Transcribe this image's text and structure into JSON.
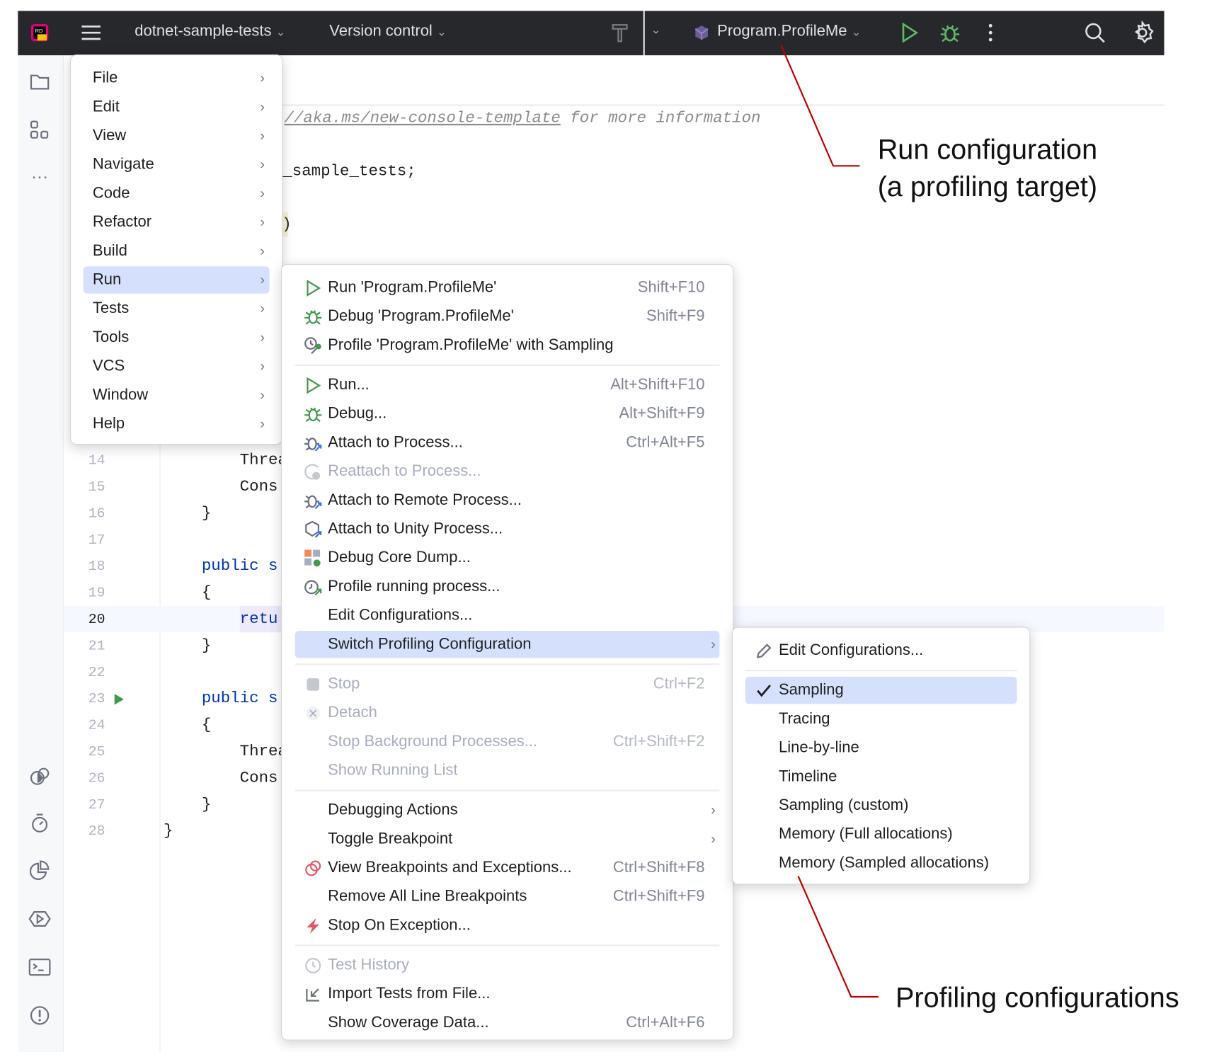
{
  "colors": {
    "accent": "#d5e1fc",
    "run_green": "#3f9a4a",
    "annotation_red": "#c00000",
    "topbar": "#27282c"
  },
  "topbar": {
    "project": "dotnet-sample-tests",
    "vcs": "Version control",
    "run_config": "Program.ProfileMe",
    "icons": [
      "ide-logo-icon",
      "hamburger-menu-icon",
      "hammer-icon",
      "config-icon",
      "run-icon",
      "debug-icon",
      "more-icon",
      "search-icon",
      "settings-icon"
    ]
  },
  "editor": {
    "top_lines": [
      {
        "text": "//aka.ms/new-console-template",
        "rest": " for more information"
      },
      {
        "text": "_sample_tests;"
      },
      {
        "text": ")"
      }
    ],
    "lines": [
      {
        "num": "14",
        "text": "        Threa"
      },
      {
        "num": "15",
        "text": "        Cons"
      },
      {
        "num": "16",
        "text": "    }"
      },
      {
        "num": "17",
        "text": ""
      },
      {
        "num": "18",
        "text": "    public s",
        "kw": true
      },
      {
        "num": "19",
        "text": "    {"
      },
      {
        "num": "20",
        "text": "        retu",
        "kw": true,
        "current": true
      },
      {
        "num": "21",
        "text": "    }"
      },
      {
        "num": "22",
        "text": ""
      },
      {
        "num": "23",
        "text": "    public s",
        "kw": true,
        "run": true
      },
      {
        "num": "24",
        "text": "    {"
      },
      {
        "num": "25",
        "text": "        Threa"
      },
      {
        "num": "26",
        "text": "        Cons"
      },
      {
        "num": "27",
        "text": "    }"
      },
      {
        "num": "28",
        "text": "}"
      }
    ]
  },
  "main_menu": [
    {
      "label": "File",
      "submenu": true
    },
    {
      "label": "Edit",
      "submenu": true
    },
    {
      "label": "View",
      "submenu": true
    },
    {
      "label": "Navigate",
      "submenu": true
    },
    {
      "label": "Code",
      "submenu": true
    },
    {
      "label": "Refactor",
      "submenu": true
    },
    {
      "label": "Build",
      "submenu": true
    },
    {
      "label": "Run",
      "submenu": true,
      "highlight": true
    },
    {
      "label": "Tests",
      "submenu": true
    },
    {
      "label": "Tools",
      "submenu": true
    },
    {
      "label": "VCS",
      "submenu": true
    },
    {
      "label": "Window",
      "submenu": true
    },
    {
      "label": "Help",
      "submenu": true
    }
  ],
  "run_menu": [
    {
      "label": "Run 'Program.ProfileMe'",
      "shortcut": "Shift+F10",
      "icon": "run"
    },
    {
      "label": "Debug 'Program.ProfileMe'",
      "shortcut": "Shift+F9",
      "icon": "debug"
    },
    {
      "label": "Profile 'Program.ProfileMe' with Sampling",
      "icon": "profile"
    },
    {
      "sep": true
    },
    {
      "label": "Run...",
      "shortcut": "Alt+Shift+F10",
      "icon": "run"
    },
    {
      "label": "Debug...",
      "shortcut": "Alt+Shift+F9",
      "icon": "debug"
    },
    {
      "label": "Attach to Process...",
      "shortcut": "Ctrl+Alt+F5",
      "icon": "attach"
    },
    {
      "label": "Reattach to Process...",
      "icon": "reattach",
      "disabled": true
    },
    {
      "label": "Attach to Remote Process...",
      "icon": "attach"
    },
    {
      "label": "Attach to Unity Process...",
      "icon": "unity"
    },
    {
      "label": "Debug Core Dump...",
      "icon": "coredump"
    },
    {
      "label": "Profile running process...",
      "icon": "profile-running"
    },
    {
      "label": "Edit Configurations..."
    },
    {
      "label": "Switch Profiling Configuration",
      "submenu": true,
      "highlight": true
    },
    {
      "sep": true
    },
    {
      "label": "Stop",
      "shortcut": "Ctrl+F2",
      "icon": "stop",
      "disabled": true
    },
    {
      "label": "Detach",
      "icon": "detach",
      "disabled": true
    },
    {
      "label": "Stop Background Processes...",
      "shortcut": "Ctrl+Shift+F2",
      "disabled": true
    },
    {
      "label": "Show Running List",
      "disabled": true
    },
    {
      "sep": true
    },
    {
      "label": "Debugging Actions",
      "submenu": true
    },
    {
      "label": "Toggle Breakpoint",
      "submenu": true
    },
    {
      "label": "View Breakpoints and Exceptions...",
      "shortcut": "Ctrl+Shift+F8",
      "icon": "breakpoints"
    },
    {
      "label": "Remove All Line Breakpoints",
      "shortcut": "Ctrl+Shift+F9"
    },
    {
      "label": "Stop On Exception...",
      "icon": "exception"
    },
    {
      "sep": true
    },
    {
      "label": "Test History",
      "icon": "history",
      "disabled": true
    },
    {
      "label": "Import Tests from File...",
      "icon": "import"
    },
    {
      "label": "Show Coverage Data...",
      "shortcut": "Ctrl+Alt+F6"
    }
  ],
  "profiling_menu": [
    {
      "label": "Edit Configurations...",
      "icon": "pencil"
    },
    {
      "sep": true
    },
    {
      "label": "Sampling",
      "icon": "check",
      "highlight": true
    },
    {
      "label": "Tracing"
    },
    {
      "label": "Line-by-line"
    },
    {
      "label": "Timeline"
    },
    {
      "label": "Sampling (custom)"
    },
    {
      "label": "Memory (Full allocations)"
    },
    {
      "label": "Memory (Sampled allocations)"
    }
  ],
  "annotations": {
    "run_config": [
      "Run configuration",
      "(a profiling target)"
    ],
    "profiling": "Profiling configurations"
  }
}
